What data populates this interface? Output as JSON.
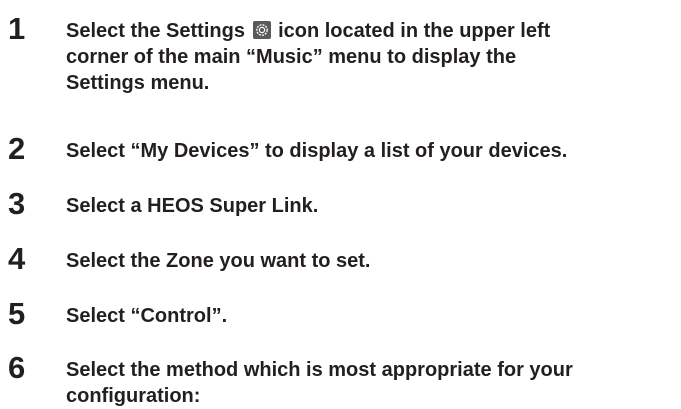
{
  "steps": [
    {
      "number": "1",
      "line1_before_icon": "Select the Settings",
      "icon": "settings-icon",
      "line1_after_icon": "icon located in the upper left",
      "line2": "corner of the main “Music” menu to display the",
      "line3": "Settings menu."
    },
    {
      "number": "2",
      "line1": "Select “My Devices” to display a list of your devices."
    },
    {
      "number": "3",
      "line1": "Select a HEOS Super Link."
    },
    {
      "number": "4",
      "line1": "Select the Zone you want to set."
    },
    {
      "number": "5",
      "line1": "Select “Control”."
    },
    {
      "number": "6",
      "line1": "Select the method which is most appropriate for your",
      "line2": "configuration:"
    }
  ]
}
